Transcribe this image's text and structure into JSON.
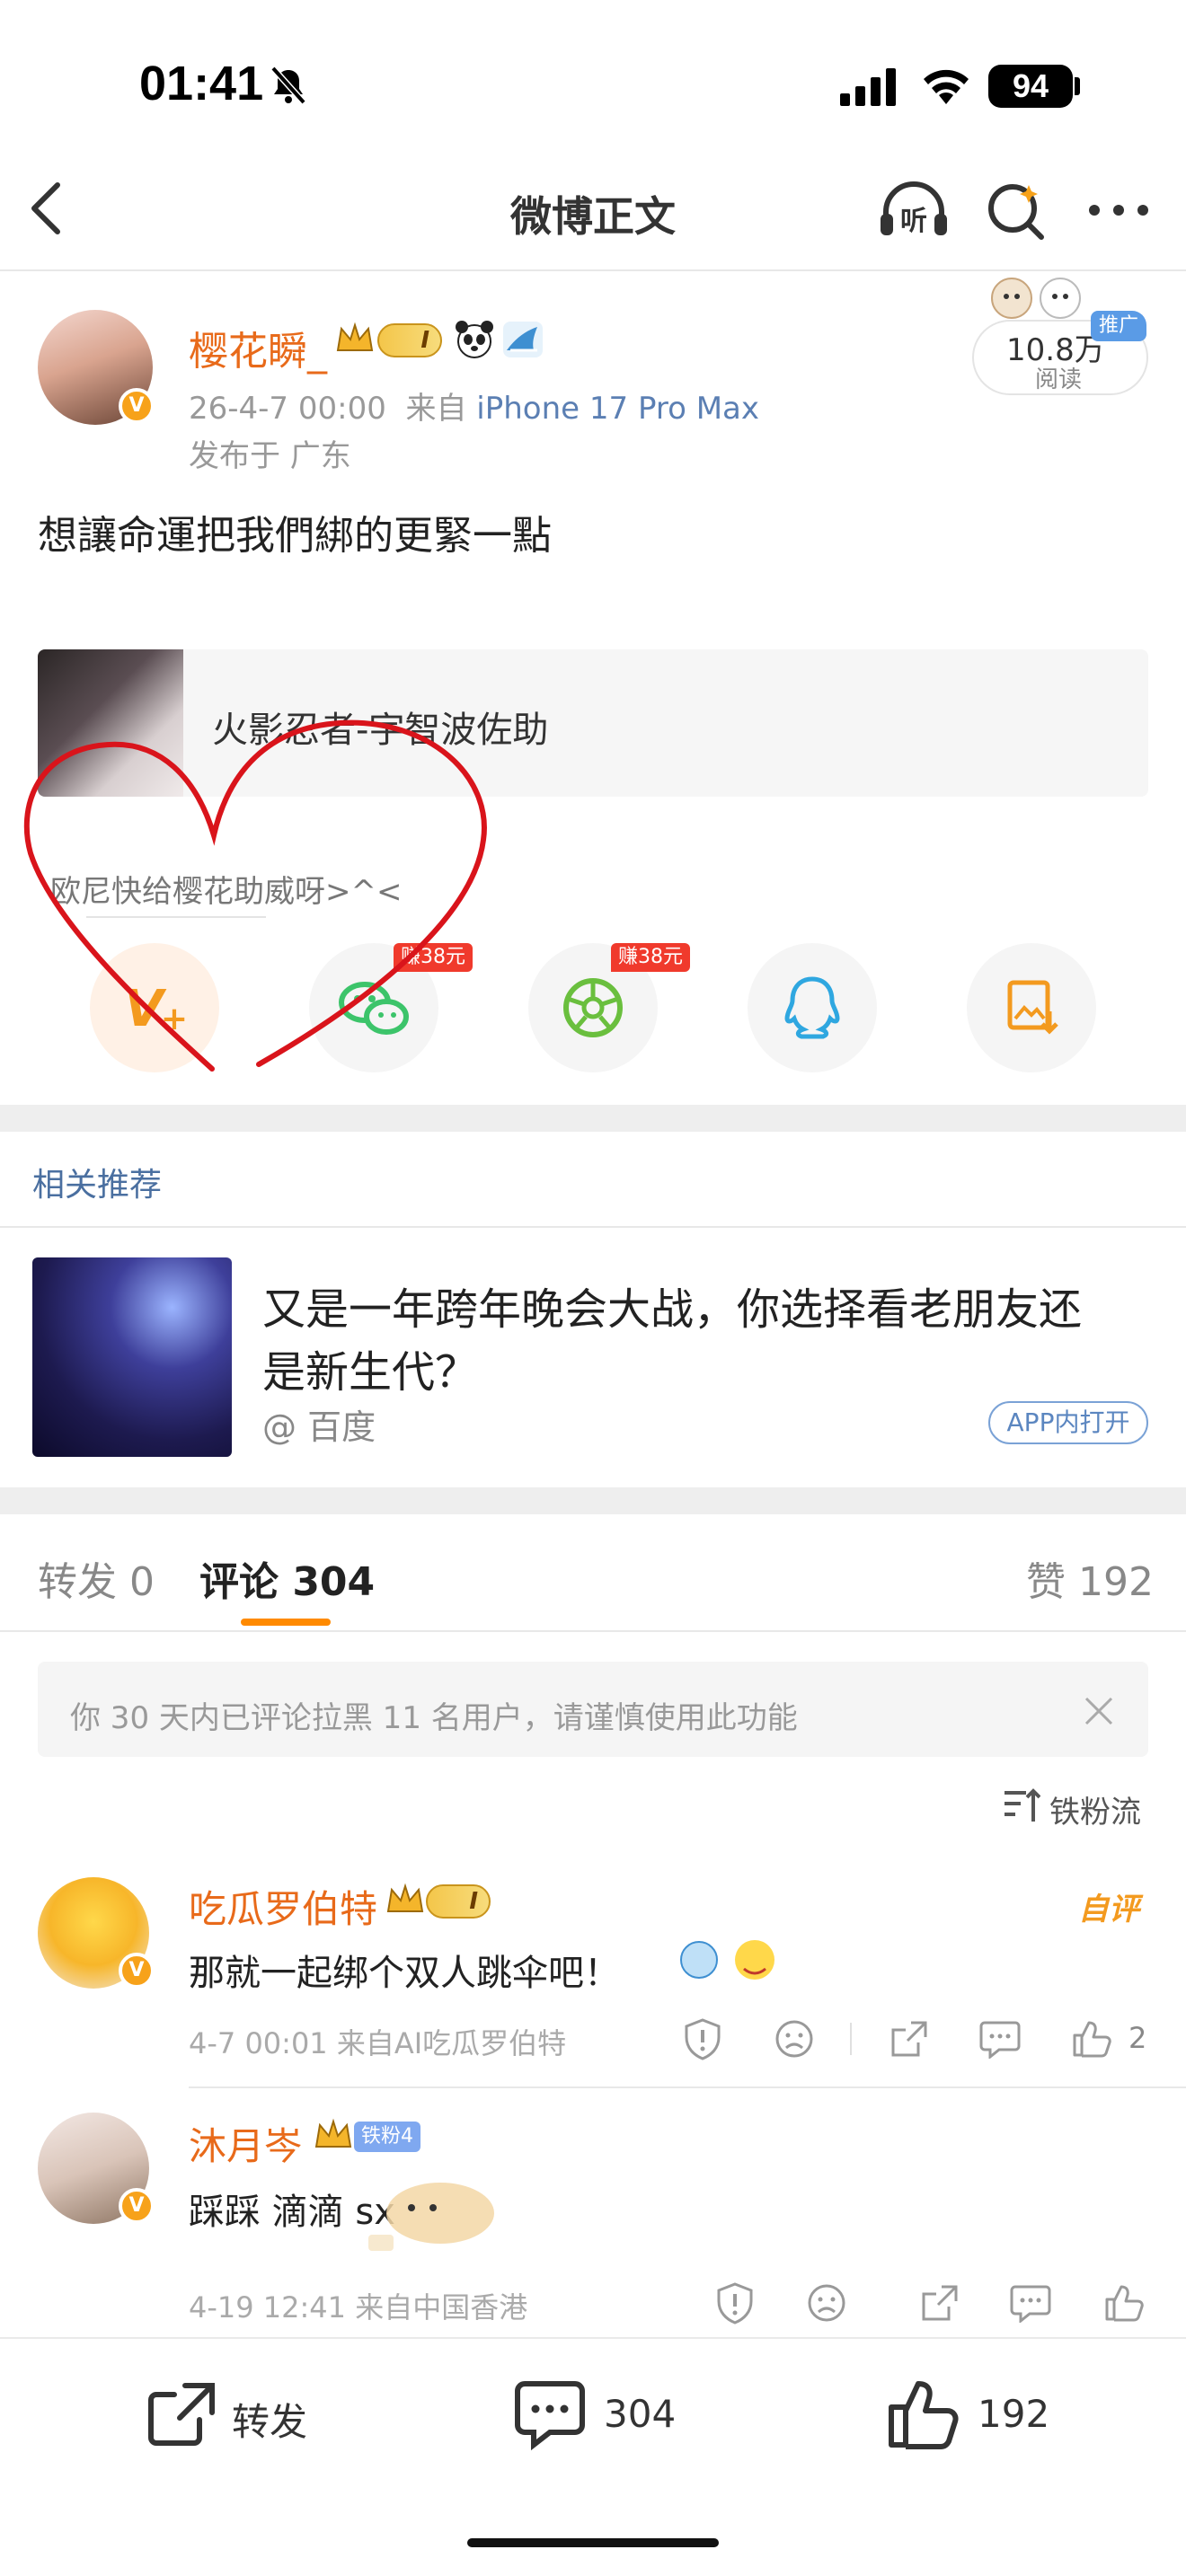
{
  "status_bar": {
    "time": "01:41",
    "battery": "94"
  },
  "nav": {
    "title": "微博正文"
  },
  "post": {
    "author": "樱花瞬_",
    "vip_level": "I",
    "date": "26-4-7 00:00",
    "source_prefix": "来自",
    "device": "iPhone 17 Pro Max",
    "location": "发布于 广东",
    "read_count": "10.8万",
    "read_label": "阅读",
    "ad_tag": "推广",
    "text": "想讓命運把我們綁的更緊一點",
    "card_title": "火影忍者-宇智波佐助"
  },
  "share": {
    "title": "欧尼快给樱花助威呀>^<",
    "wechat_tag": "赚38元",
    "moments_tag": "赚38元"
  },
  "related": {
    "section_title": "相关推荐",
    "headline_line1": "又是一年跨年晚会大战，你选择看老朋友还",
    "headline_line2": "是新生代？",
    "source": "@ 百度",
    "open_button": "APP内打开"
  },
  "tabs": {
    "repost": "转发 0",
    "comments": "评论 304",
    "likes": "赞 192"
  },
  "notice": {
    "text": "你 30 天内已评论拉黑 11 名用户，请谨慎使用此功能"
  },
  "sort": {
    "label": "铁粉流"
  },
  "comments": [
    {
      "name": "吃瓜罗伯特",
      "vip_level": "I",
      "badge": "自评",
      "text": "那就一起绑个双人跳伞吧！",
      "meta": "4-7 00:01  来自AI吃瓜罗伯特",
      "likes": "2"
    },
    {
      "name": "沐月岑",
      "fan_badge": "铁粉4",
      "text": "踩踩 滴滴 sx",
      "meta": "4-19 12:41  来自中国香港"
    }
  ],
  "bottom_bar": {
    "repost": "转发",
    "comments": "304",
    "likes": "192"
  },
  "colors": {
    "accent": "#ff8a00",
    "username": "#e86a1a",
    "link": "#4a6fa0",
    "annotation": "#d9141b"
  }
}
